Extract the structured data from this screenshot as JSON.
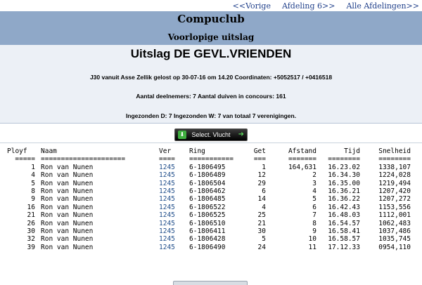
{
  "nav": {
    "prev": "<<Vorige",
    "next": "Afdeling 6>>",
    "all": "Alle Afdelingen>>"
  },
  "header": {
    "club": "Compuclub",
    "subtitle": "Voorlopige uitslag"
  },
  "info": {
    "title": "Uitslag DE GEVL.VRIENDEN",
    "line1": "J30 vanuit Asse Zellik gelost op 30-07-16 om 14.20 Coordinaten: +5052517 / +0416518",
    "line2": "Aantal deelnemers: 7 Aantal duiven in concours: 161",
    "line3": "Ingezonden D: 7 Ingezonden W: 7 van totaal 7 verenigingen."
  },
  "button": {
    "label": "Select. Vlucht",
    "icon": "download-icon",
    "arrow": "arrow-right-icon"
  },
  "table": {
    "headers": [
      "Ployf",
      "Naam",
      "Ver",
      "Ring",
      "Get",
      "Afstand",
      "Tijd",
      "Snelheid"
    ],
    "underlines": [
      "=====",
      "=====================",
      "====",
      "===========",
      "===",
      "=======",
      "========",
      "========"
    ],
    "rows": [
      [
        "1",
        "Ron van Nunen",
        "1245",
        "6-1806495",
        "1",
        "164,631",
        "16.23.02",
        "1338,107"
      ],
      [
        "4",
        "Ron van Nunen",
        "1245",
        "6-1806489",
        "12",
        "2",
        "16.34.30",
        "1224,028"
      ],
      [
        "5",
        "Ron van Nunen",
        "1245",
        "6-1806504",
        "29",
        "3",
        "16.35.00",
        "1219,494"
      ],
      [
        "8",
        "Ron van Nunen",
        "1245",
        "6-1806462",
        "6",
        "4",
        "16.36.21",
        "1207,420"
      ],
      [
        "9",
        "Ron van Nunen",
        "1245",
        "6-1806485",
        "14",
        "5",
        "16.36.22",
        "1207,272"
      ],
      [
        "16",
        "Ron van Nunen",
        "1245",
        "6-1806522",
        "4",
        "6",
        "16.42.43",
        "1153,556"
      ],
      [
        "21",
        "Ron van Nunen",
        "1245",
        "6-1806525",
        "25",
        "7",
        "16.48.03",
        "1112,001"
      ],
      [
        "26",
        "Ron van Nunen",
        "1245",
        "6-1806510",
        "21",
        "8",
        "16.54.57",
        "1062,483"
      ],
      [
        "30",
        "Ron van Nunen",
        "1245",
        "6-1806411",
        "30",
        "9",
        "16.58.41",
        "1037,486"
      ],
      [
        "32",
        "Ron van Nunen",
        "1245",
        "6-1806428",
        "5",
        "10",
        "16.58.57",
        "1035,745"
      ],
      [
        "39",
        "Ron van Nunen",
        "1245",
        "6-1806490",
        "24",
        "11",
        "17.12.33",
        "0954,110"
      ]
    ]
  },
  "colors": {
    "band": "#8fa8c8",
    "info_bg": "#ecf0f6",
    "link": "#1f3f8a"
  }
}
